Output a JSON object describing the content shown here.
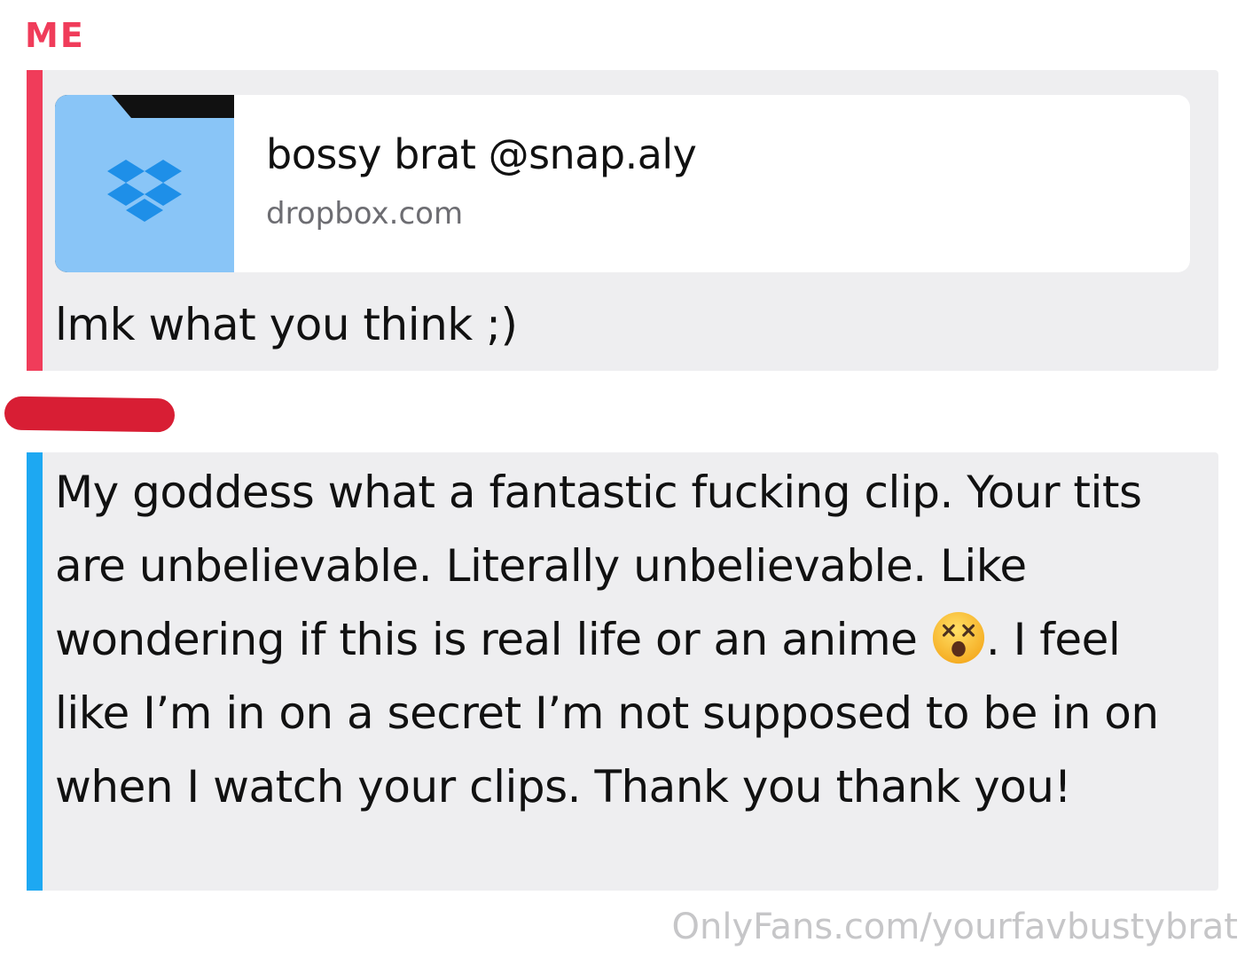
{
  "me_label": "ME",
  "colors": {
    "me_accent": "#f03c5a",
    "them_accent": "#1da8f2",
    "bubble_bg": "#eeeef0",
    "redaction": "#d81e34"
  },
  "link_card": {
    "title": "bossy brat @snap.aly",
    "domain": "dropbox.com",
    "thumbnail_icon": "dropbox-folder-icon"
  },
  "me_message": "lmk what you think ;)",
  "them_message": {
    "part1": "My goddess what a fantastic fucking clip. Your tits are unbelievable. Literally unbelievable. Like wondering if this is real life or an anime ",
    "emoji_icon": "dizzy-face-emoji",
    "part2": ". I feel like I’m in on a secret I’m not supposed to be in on when I watch your clips.  Thank you thank you!"
  },
  "watermark": "OnlyFans.com/yourfavbustybrat"
}
